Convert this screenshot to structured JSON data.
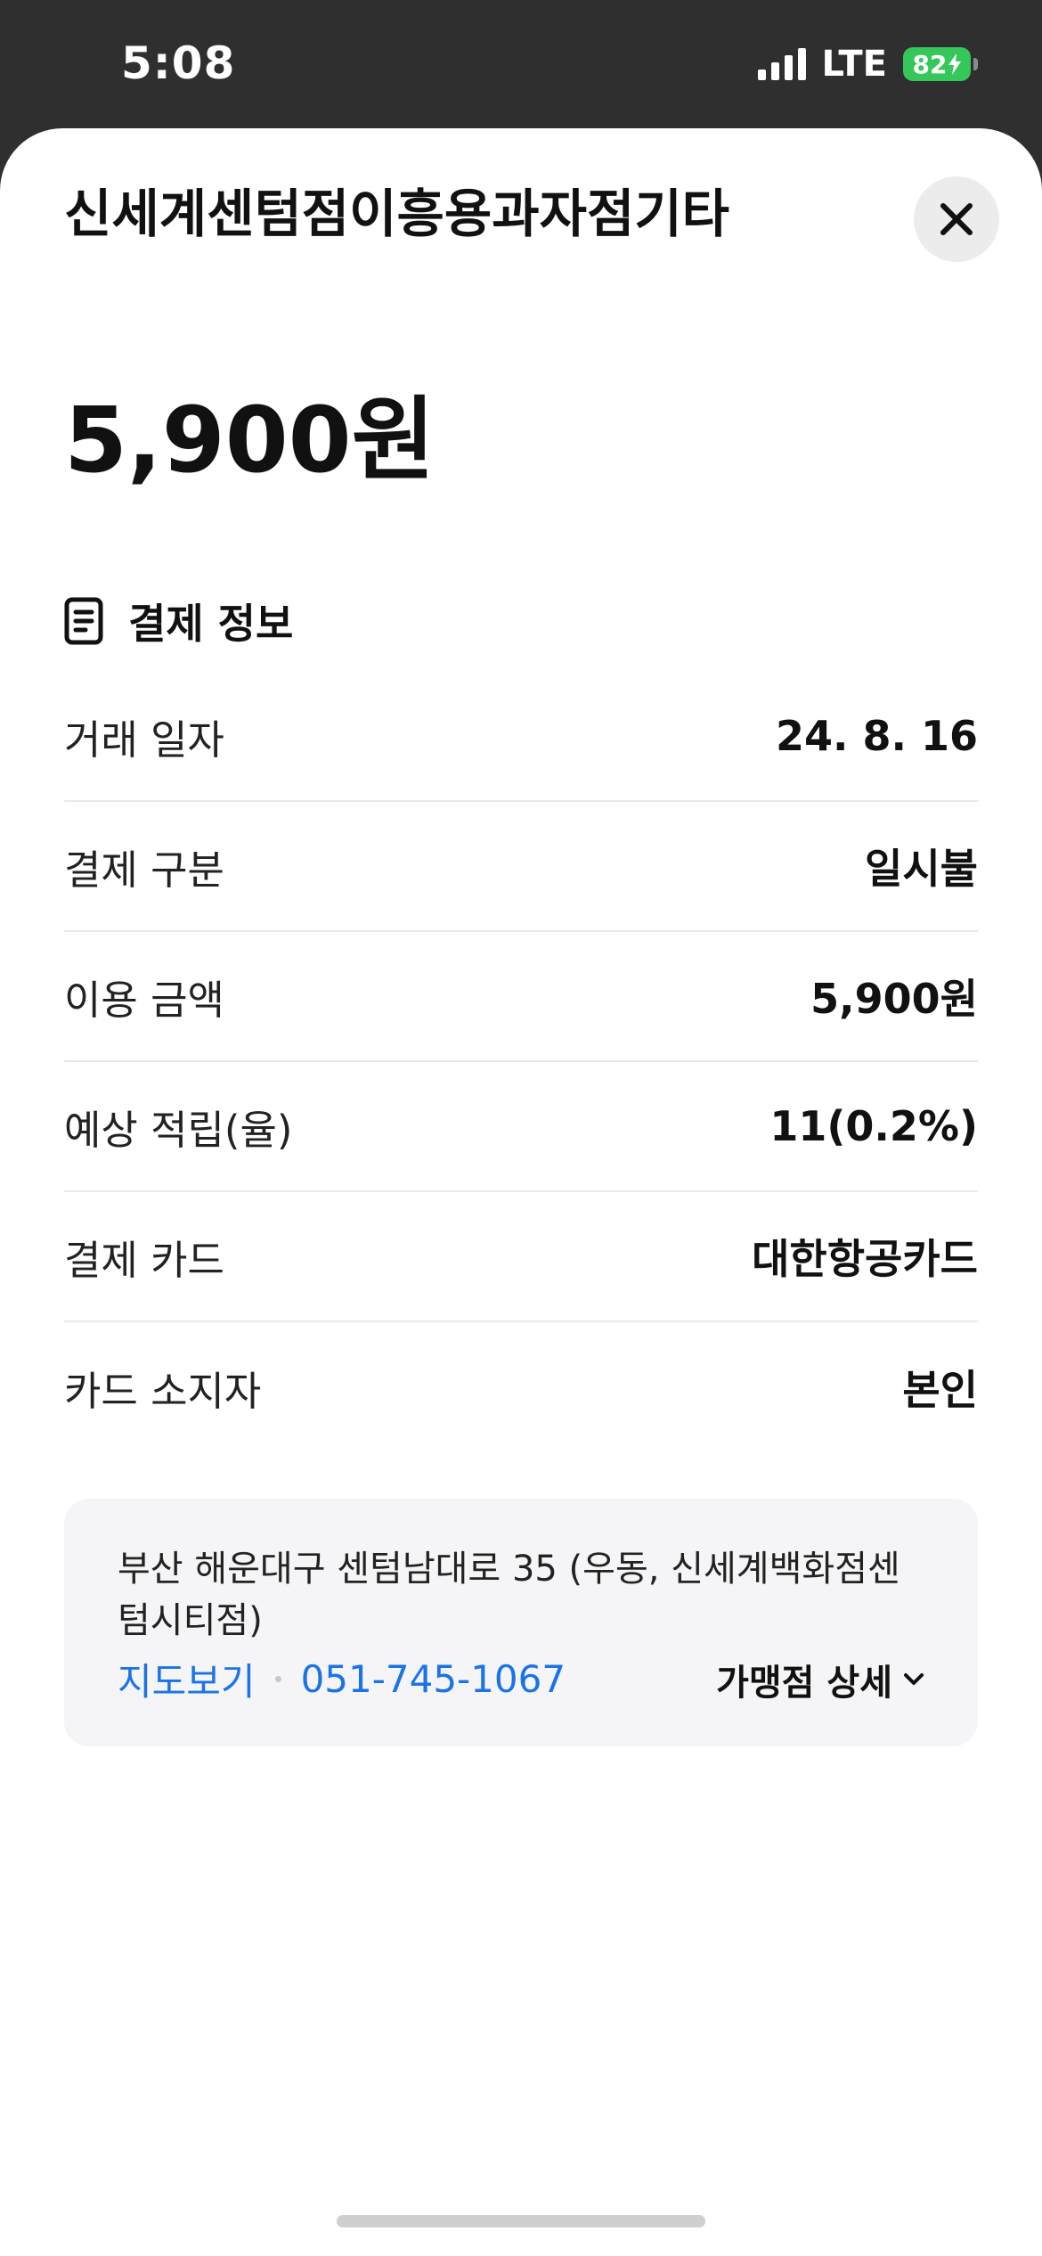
{
  "status_bar": {
    "time": "5:08",
    "network": "LTE",
    "battery": "82"
  },
  "header": {
    "merchant_name": "신세계센텀점이흥용과자점기타",
    "close_icon": "close-icon"
  },
  "amount": "5,900원",
  "payment_info": {
    "section_title": "결제 정보",
    "icon": "receipt-icon",
    "rows": [
      {
        "label": "거래 일자",
        "value": "24. 8. 16"
      },
      {
        "label": "결제 구분",
        "value": "일시불"
      },
      {
        "label": "이용 금액",
        "value": "5,900원"
      },
      {
        "label": "예상 적립(율)",
        "value": "11(0.2%)"
      },
      {
        "label": "결제 카드",
        "value": "대한항공카드"
      },
      {
        "label": "카드 소지자",
        "value": "본인"
      }
    ]
  },
  "merchant": {
    "address": "부산 해운대구 센텀남대로 35 (우동, 신세계백화점센텀시티점)",
    "map_link": "지도보기",
    "phone": "051-745-1067",
    "detail_label": "가맹점 상세"
  },
  "colors": {
    "link": "#1a73e8",
    "card_background": "#f5f5f7",
    "battery": "#35c759"
  }
}
